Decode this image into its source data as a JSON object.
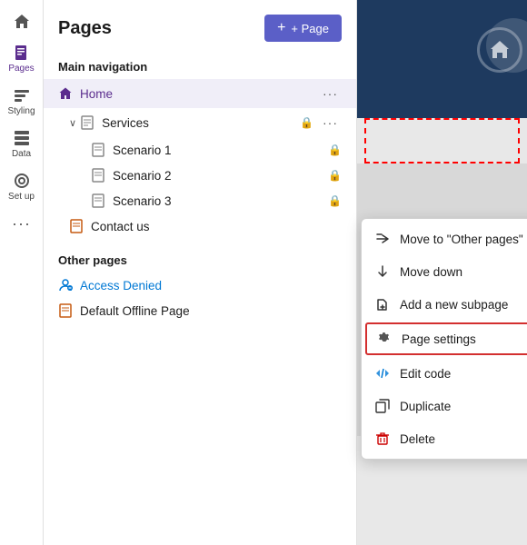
{
  "sidebar": {
    "items": [
      {
        "id": "home",
        "label": "",
        "icon": "home"
      },
      {
        "id": "pages",
        "label": "Pages",
        "icon": "pages",
        "active": true
      },
      {
        "id": "styling",
        "label": "Styling",
        "icon": "styling"
      },
      {
        "id": "data",
        "label": "Data",
        "icon": "data"
      },
      {
        "id": "setup",
        "label": "Set up",
        "icon": "setup"
      },
      {
        "id": "more",
        "label": "...",
        "icon": "more"
      }
    ]
  },
  "header": {
    "title": "Pages",
    "add_button": "+ Page"
  },
  "main_nav": {
    "section_label": "Main navigation",
    "items": [
      {
        "id": "home",
        "label": "Home",
        "type": "home",
        "active": true,
        "indent": 0
      },
      {
        "id": "services",
        "label": "Services",
        "type": "page",
        "indent": 1,
        "has_chevron": true,
        "has_lock": true,
        "has_more": true
      },
      {
        "id": "scenario1",
        "label": "Scenario 1",
        "type": "page",
        "indent": 2,
        "has_lock": true
      },
      {
        "id": "scenario2",
        "label": "Scenario 2",
        "type": "page",
        "indent": 2,
        "has_lock": true
      },
      {
        "id": "scenario3",
        "label": "Scenario 3",
        "type": "page",
        "indent": 2,
        "has_lock": true
      },
      {
        "id": "contact",
        "label": "Contact us",
        "type": "page-orange",
        "indent": 1
      }
    ]
  },
  "other_pages": {
    "section_label": "Other pages",
    "items": [
      {
        "id": "access-denied",
        "label": "Access Denied",
        "type": "user",
        "color": "blue"
      },
      {
        "id": "offline",
        "label": "Default Offline Page",
        "type": "page-orange"
      }
    ]
  },
  "context_menu": {
    "items": [
      {
        "id": "move-other",
        "label": "Move to \"Other pages\"",
        "icon": "move",
        "icon_type": "dark"
      },
      {
        "id": "move-down",
        "label": "Move down",
        "icon": "down",
        "icon_type": "dark"
      },
      {
        "id": "add-subpage",
        "label": "Add a new subpage",
        "icon": "subpage",
        "icon_type": "dark"
      },
      {
        "id": "page-settings",
        "label": "Page settings",
        "icon": "gear",
        "icon_type": "gear",
        "highlighted": true
      },
      {
        "id": "edit-code",
        "label": "Edit code",
        "icon": "code",
        "icon_type": "blue"
      },
      {
        "id": "duplicate",
        "label": "Duplicate",
        "icon": "duplicate",
        "icon_type": "dark"
      },
      {
        "id": "delete",
        "label": "Delete",
        "icon": "delete",
        "icon_type": "red"
      }
    ]
  }
}
